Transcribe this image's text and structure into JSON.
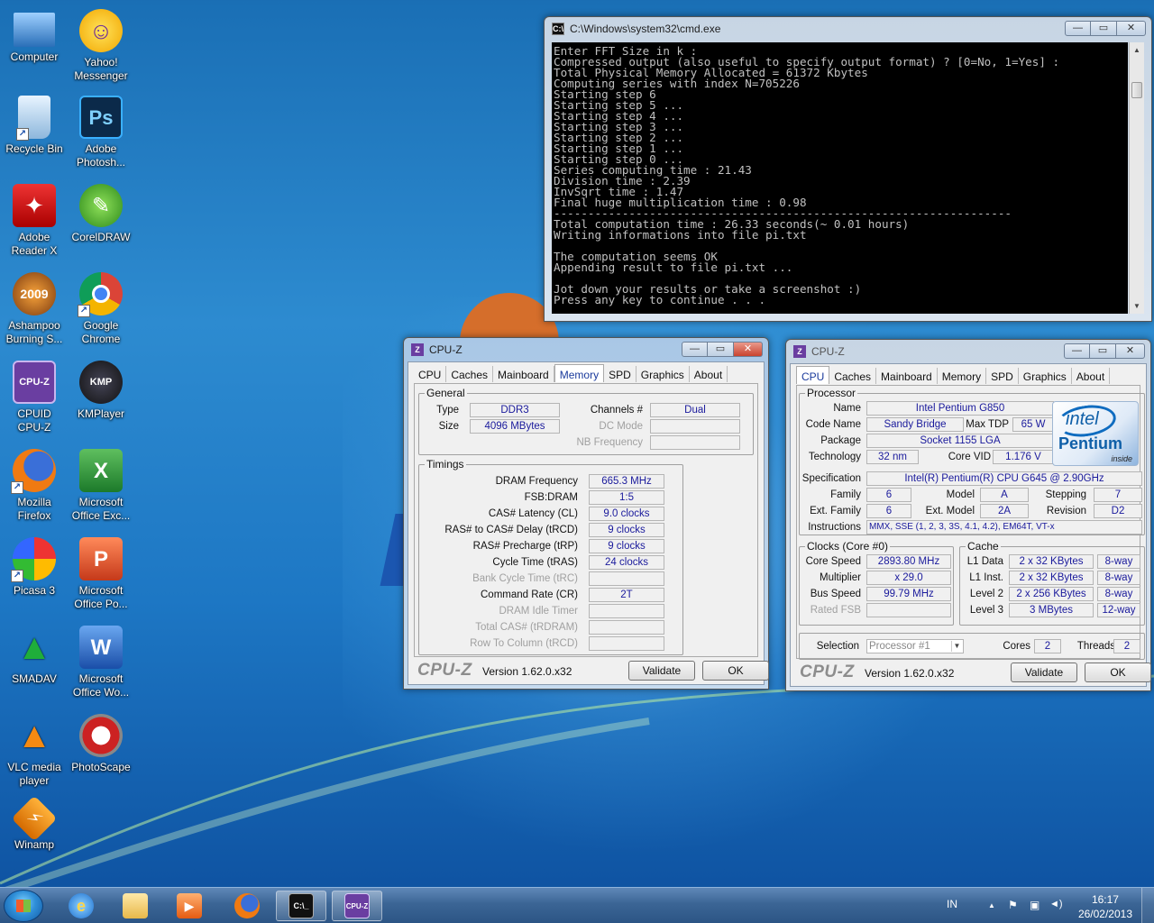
{
  "desktop": {
    "icons": [
      {
        "name": "computer",
        "label_line1": "Computer",
        "label_line2": ""
      },
      {
        "name": "yahoo-messenger",
        "label_line1": "Yahoo!",
        "label_line2": "Messenger"
      },
      {
        "name": "recycle-bin",
        "label_line1": "Recycle Bin",
        "label_line2": ""
      },
      {
        "name": "adobe-photoshop",
        "label_line1": "Adobe",
        "label_line2": "Photosh..."
      },
      {
        "name": "adobe-reader",
        "label_line1": "Adobe",
        "label_line2": "Reader X"
      },
      {
        "name": "coreldraw",
        "label_line1": "CorelDRAW",
        "label_line2": ""
      },
      {
        "name": "ashampoo",
        "label_line1": "Ashampoo",
        "label_line2": "Burning S..."
      },
      {
        "name": "google-chrome",
        "label_line1": "Google",
        "label_line2": "Chrome"
      },
      {
        "name": "cpuid-cpuz",
        "label_line1": "CPUID",
        "label_line2": "CPU-Z"
      },
      {
        "name": "kmplayer",
        "label_line1": "KMPlayer",
        "label_line2": ""
      },
      {
        "name": "mozilla-firefox",
        "label_line1": "Mozilla",
        "label_line2": "Firefox"
      },
      {
        "name": "ms-excel",
        "label_line1": "Microsoft",
        "label_line2": "Office Exc..."
      },
      {
        "name": "picasa",
        "label_line1": "Picasa 3",
        "label_line2": ""
      },
      {
        "name": "ms-powerpoint",
        "label_line1": "Microsoft",
        "label_line2": "Office Po..."
      },
      {
        "name": "smadav",
        "label_line1": "SMADAV",
        "label_line2": ""
      },
      {
        "name": "ms-word",
        "label_line1": "Microsoft",
        "label_line2": "Office Wo..."
      },
      {
        "name": "vlc",
        "label_line1": "VLC media",
        "label_line2": "player"
      },
      {
        "name": "photoscape",
        "label_line1": "PhotoScape",
        "label_line2": ""
      },
      {
        "name": "winamp",
        "label_line1": "Winamp",
        "label_line2": ""
      }
    ],
    "icon_glyphs": {
      "yahoo": "☺",
      "ps": "Ps",
      "pdf": "✦",
      "corel": "✎",
      "ash": "2009",
      "cpuz": "CPU-Z",
      "kmp": "KMP",
      "excel": "X",
      "ppt": "P",
      "word": "W",
      "smadav": "▲",
      "vlc": "▲",
      "winamp": "⚡",
      "photoscape": "◐"
    }
  },
  "cmd": {
    "title": "C:\\Windows\\system32\\cmd.exe",
    "icon_text": "C:\\",
    "lines": [
      "Enter FFT Size in k :",
      "Compressed output (also useful to specify output format) ? [0=No, 1=Yes] :",
      "Total Physical Memory Allocated = 61372 Kbytes",
      "Computing series with index N=705226",
      "Starting step 6",
      "Starting step 5 ...",
      "Starting step 4 ...",
      "Starting step 3 ...",
      "Starting step 2 ...",
      "Starting step 1 ...",
      "Starting step 0 ...",
      "Series computing time : 21.43",
      "Division time : 2.39",
      "InvSqrt time : 1.47",
      "Final huge multiplication time : 0.98",
      "-------------------------------------------------------------------",
      "Total computation time : 26.33 seconds(~ 0.01 hours)",
      "Writing informations into file pi.txt",
      "",
      "The computation seems OK",
      "Appending result to file pi.txt ...",
      "",
      "Jot down your results or take a screenshot :)",
      "Press any key to continue . . ."
    ]
  },
  "window_controls": {
    "minimize": "—",
    "maximize": "▭",
    "close": "✕"
  },
  "cpuz_common": {
    "app_icon_text": "Z",
    "title": "CPU-Z",
    "tabs": [
      "CPU",
      "Caches",
      "Mainboard",
      "Memory",
      "SPD",
      "Graphics",
      "About"
    ],
    "logo": "CPU-Z",
    "version": "Version 1.62.0.x32",
    "validate": "Validate",
    "ok": "OK"
  },
  "cpuz_memory": {
    "active_tab": "Memory",
    "general": {
      "title": "General",
      "type_label": "Type",
      "type": "DDR3",
      "size_label": "Size",
      "size": "4096 MBytes",
      "channels_label": "Channels #",
      "channels": "Dual",
      "dc_mode_label": "DC Mode",
      "dc_mode": "",
      "nb_freq_label": "NB Frequency",
      "nb_freq": ""
    },
    "timings": {
      "title": "Timings",
      "rows": [
        {
          "label": "DRAM Frequency",
          "value": "665.3 MHz",
          "disabled": false
        },
        {
          "label": "FSB:DRAM",
          "value": "1:5",
          "disabled": false
        },
        {
          "label": "CAS# Latency (CL)",
          "value": "9.0 clocks",
          "disabled": false
        },
        {
          "label": "RAS# to CAS# Delay (tRCD)",
          "value": "9 clocks",
          "disabled": false
        },
        {
          "label": "RAS# Precharge (tRP)",
          "value": "9 clocks",
          "disabled": false
        },
        {
          "label": "Cycle Time (tRAS)",
          "value": "24 clocks",
          "disabled": false
        },
        {
          "label": "Bank Cycle Time (tRC)",
          "value": "",
          "disabled": true
        },
        {
          "label": "Command Rate (CR)",
          "value": "2T",
          "disabled": false
        },
        {
          "label": "DRAM Idle Timer",
          "value": "",
          "disabled": true
        },
        {
          "label": "Total CAS# (tRDRAM)",
          "value": "",
          "disabled": true
        },
        {
          "label": "Row To Column (tRCD)",
          "value": "",
          "disabled": true
        }
      ]
    }
  },
  "cpuz_cpu": {
    "active_tab": "CPU",
    "processor": {
      "title": "Processor",
      "name_label": "Name",
      "name": "Intel Pentium G850",
      "code_name_label": "Code Name",
      "code_name": "Sandy Bridge",
      "max_tdp_label": "Max TDP",
      "max_tdp": "65 W",
      "package_label": "Package",
      "package": "Socket 1155 LGA",
      "technology_label": "Technology",
      "technology": "32 nm",
      "core_vid_label": "Core VID",
      "core_vid": "1.176 V",
      "spec_label": "Specification",
      "spec": "Intel(R) Pentium(R) CPU G645 @ 2.90GHz",
      "family_label": "Family",
      "family": "6",
      "model_label": "Model",
      "model": "A",
      "stepping_label": "Stepping",
      "stepping": "7",
      "ext_family_label": "Ext. Family",
      "ext_family": "6",
      "ext_model_label": "Ext. Model",
      "ext_model": "2A",
      "revision_label": "Revision",
      "revision": "D2",
      "instructions_label": "Instructions",
      "instructions": "MMX, SSE (1, 2, 3, 3S, 4.1, 4.2), EM64T, VT-x"
    },
    "intel_logo": {
      "brand": "intel",
      "product": "Pentium",
      "tag": "inside"
    },
    "clocks": {
      "title": "Clocks (Core #0)",
      "core_speed_label": "Core Speed",
      "core_speed": "2893.80 MHz",
      "multiplier_label": "Multiplier",
      "multiplier": "x 29.0",
      "bus_speed_label": "Bus Speed",
      "bus_speed": "99.79 MHz",
      "rated_fsb_label": "Rated FSB",
      "rated_fsb": ""
    },
    "cache": {
      "title": "Cache",
      "rows": [
        {
          "label": "L1 Data",
          "size": "2 x 32 KBytes",
          "assoc": "8-way"
        },
        {
          "label": "L1 Inst.",
          "size": "2 x 32 KBytes",
          "assoc": "8-way"
        },
        {
          "label": "Level 2",
          "size": "2 x 256 KBytes",
          "assoc": "8-way"
        },
        {
          "label": "Level 3",
          "size": "3 MBytes",
          "assoc": "12-way"
        }
      ]
    },
    "selection_label": "Selection",
    "selection": "Processor #1",
    "cores_label": "Cores",
    "cores": "2",
    "threads_label": "Threads",
    "threads": "2"
  },
  "taskbar": {
    "lang": "IN",
    "time": "16:17",
    "date": "26/02/2013",
    "cmd_glyph": "C:\\_",
    "cpuz_glyph": "CPU-Z",
    "tray_up": "▲",
    "tray_flag": "⚑",
    "tray_net": "▣",
    "tray_vol": "◄)"
  },
  "colors": {
    "cpuz_value": "#1a1a9c",
    "intel_blue": "#0f5fa8"
  }
}
